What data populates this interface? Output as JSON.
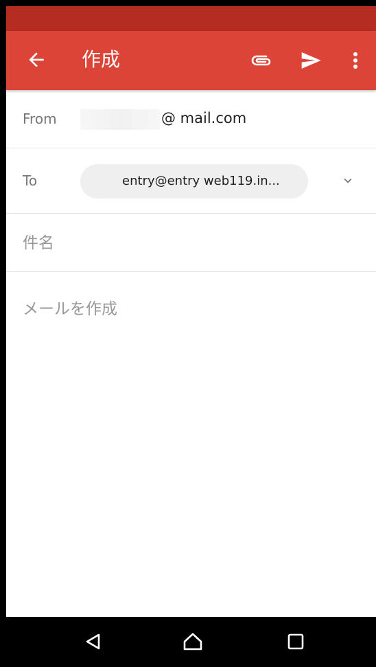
{
  "header": {
    "title": "作成",
    "icons": [
      "arrow-back-icon",
      "paperclip-icon",
      "send-icon",
      "more-vert-icon"
    ]
  },
  "compose": {
    "from_label": "From",
    "from_value": "@ mail.com",
    "to_label": "To",
    "to_chip": "entry@entry     web119.in...",
    "subject_placeholder": "件名",
    "body_placeholder": "メールを作成"
  },
  "nav": {
    "icons": [
      "nav-back-icon",
      "nav-home-icon",
      "nav-recents-icon"
    ]
  },
  "colors": {
    "status_bar": "#b52c22",
    "app_bar": "#db4437",
    "nav_bar": "#000000"
  }
}
